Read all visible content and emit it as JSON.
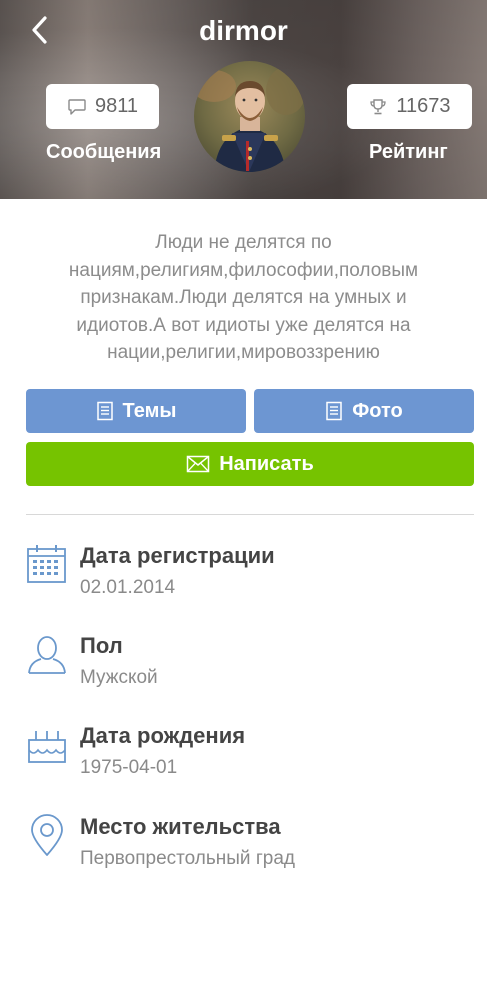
{
  "header": {
    "title": "dirmor",
    "messages": {
      "count": "9811",
      "label": "Сообщения"
    },
    "rating": {
      "count": "11673",
      "label": "Рейтинг"
    }
  },
  "status_text": "Люди не делятся по нациям,религиям,философии,половым признакам.Люди делятся на умных и идиотов.А вот идиоты уже делятся на нации,религии,мировоззрению",
  "buttons": {
    "topics": "Темы",
    "photos": "Фото",
    "write": "Написать"
  },
  "info": [
    {
      "icon": "calendar-icon",
      "title": "Дата регистрации",
      "value": "02.01.2014"
    },
    {
      "icon": "person-icon",
      "title": "Пол",
      "value": "Мужской"
    },
    {
      "icon": "cake-icon",
      "title": "Дата рождения",
      "value": "1975-04-01"
    },
    {
      "icon": "location-pin-icon",
      "title": "Место жительства",
      "value": "Первопрестольный град"
    }
  ],
  "colors": {
    "blue_button": "#6d96d2",
    "green_button": "#76c300",
    "icon_blue": "#6a98cc",
    "muted_text": "#8c8c8c"
  }
}
